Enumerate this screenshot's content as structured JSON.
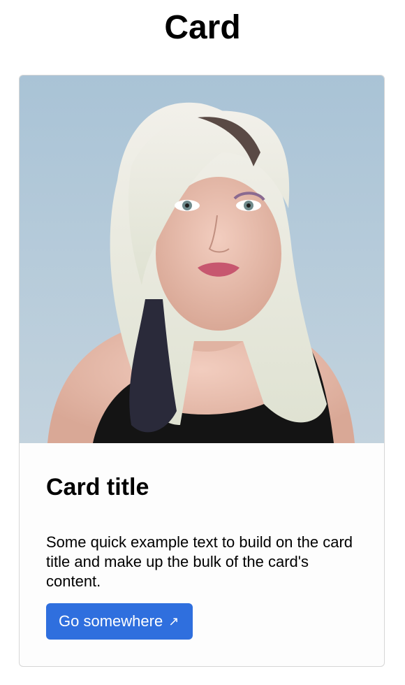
{
  "page": {
    "title": "Card"
  },
  "card": {
    "image_alt": "portrait photo of a person with platinum blonde hair",
    "title": "Card title",
    "text": "Some quick example text to build on the card title and make up the bulk of the card's content.",
    "button_label": "Go somewhere",
    "button_icon": "external-link-arrow-icon",
    "button_icon_glyph": "↗"
  },
  "colors": {
    "button_bg": "#2f6fde",
    "border": "#d6d6d6",
    "photo_background": "#b3c9d8"
  }
}
